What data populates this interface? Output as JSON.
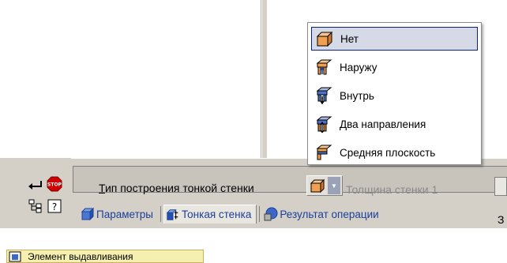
{
  "panel": {
    "field_label": "Тип построения тонкой стенки",
    "thickness_label": "Толщина стенки 1",
    "tabs": [
      {
        "label": "Параметры",
        "icon": "params-icon"
      },
      {
        "label": "Тонкая стенка",
        "icon": "thin-wall-icon"
      },
      {
        "label": "Результат операции",
        "icon": "operation-result-icon"
      }
    ],
    "tools": [
      "enter-icon",
      "stop-icon",
      "tree-icon",
      "help-icon"
    ],
    "cut_text": "З"
  },
  "menu": {
    "items": [
      {
        "label": "Нет",
        "icon": "box-none-icon",
        "selected": true
      },
      {
        "label": "Наружу",
        "icon": "outward-icon",
        "selected": false
      },
      {
        "label": "Внутрь",
        "icon": "inward-icon",
        "selected": false
      },
      {
        "label": "Два направления",
        "icon": "two-directions-icon",
        "selected": false
      },
      {
        "label": "Средняя плоскость",
        "icon": "midplane-icon",
        "selected": false
      }
    ]
  },
  "status": {
    "element_label": "Элемент выдавливания"
  },
  "colors": {
    "panel_bg": "#d4d0c8",
    "menu_selected": "#d6d9e6",
    "accent": "#1b3f9a",
    "icon_orange": "#f0a050",
    "status_bg": "#f5f0b0"
  }
}
